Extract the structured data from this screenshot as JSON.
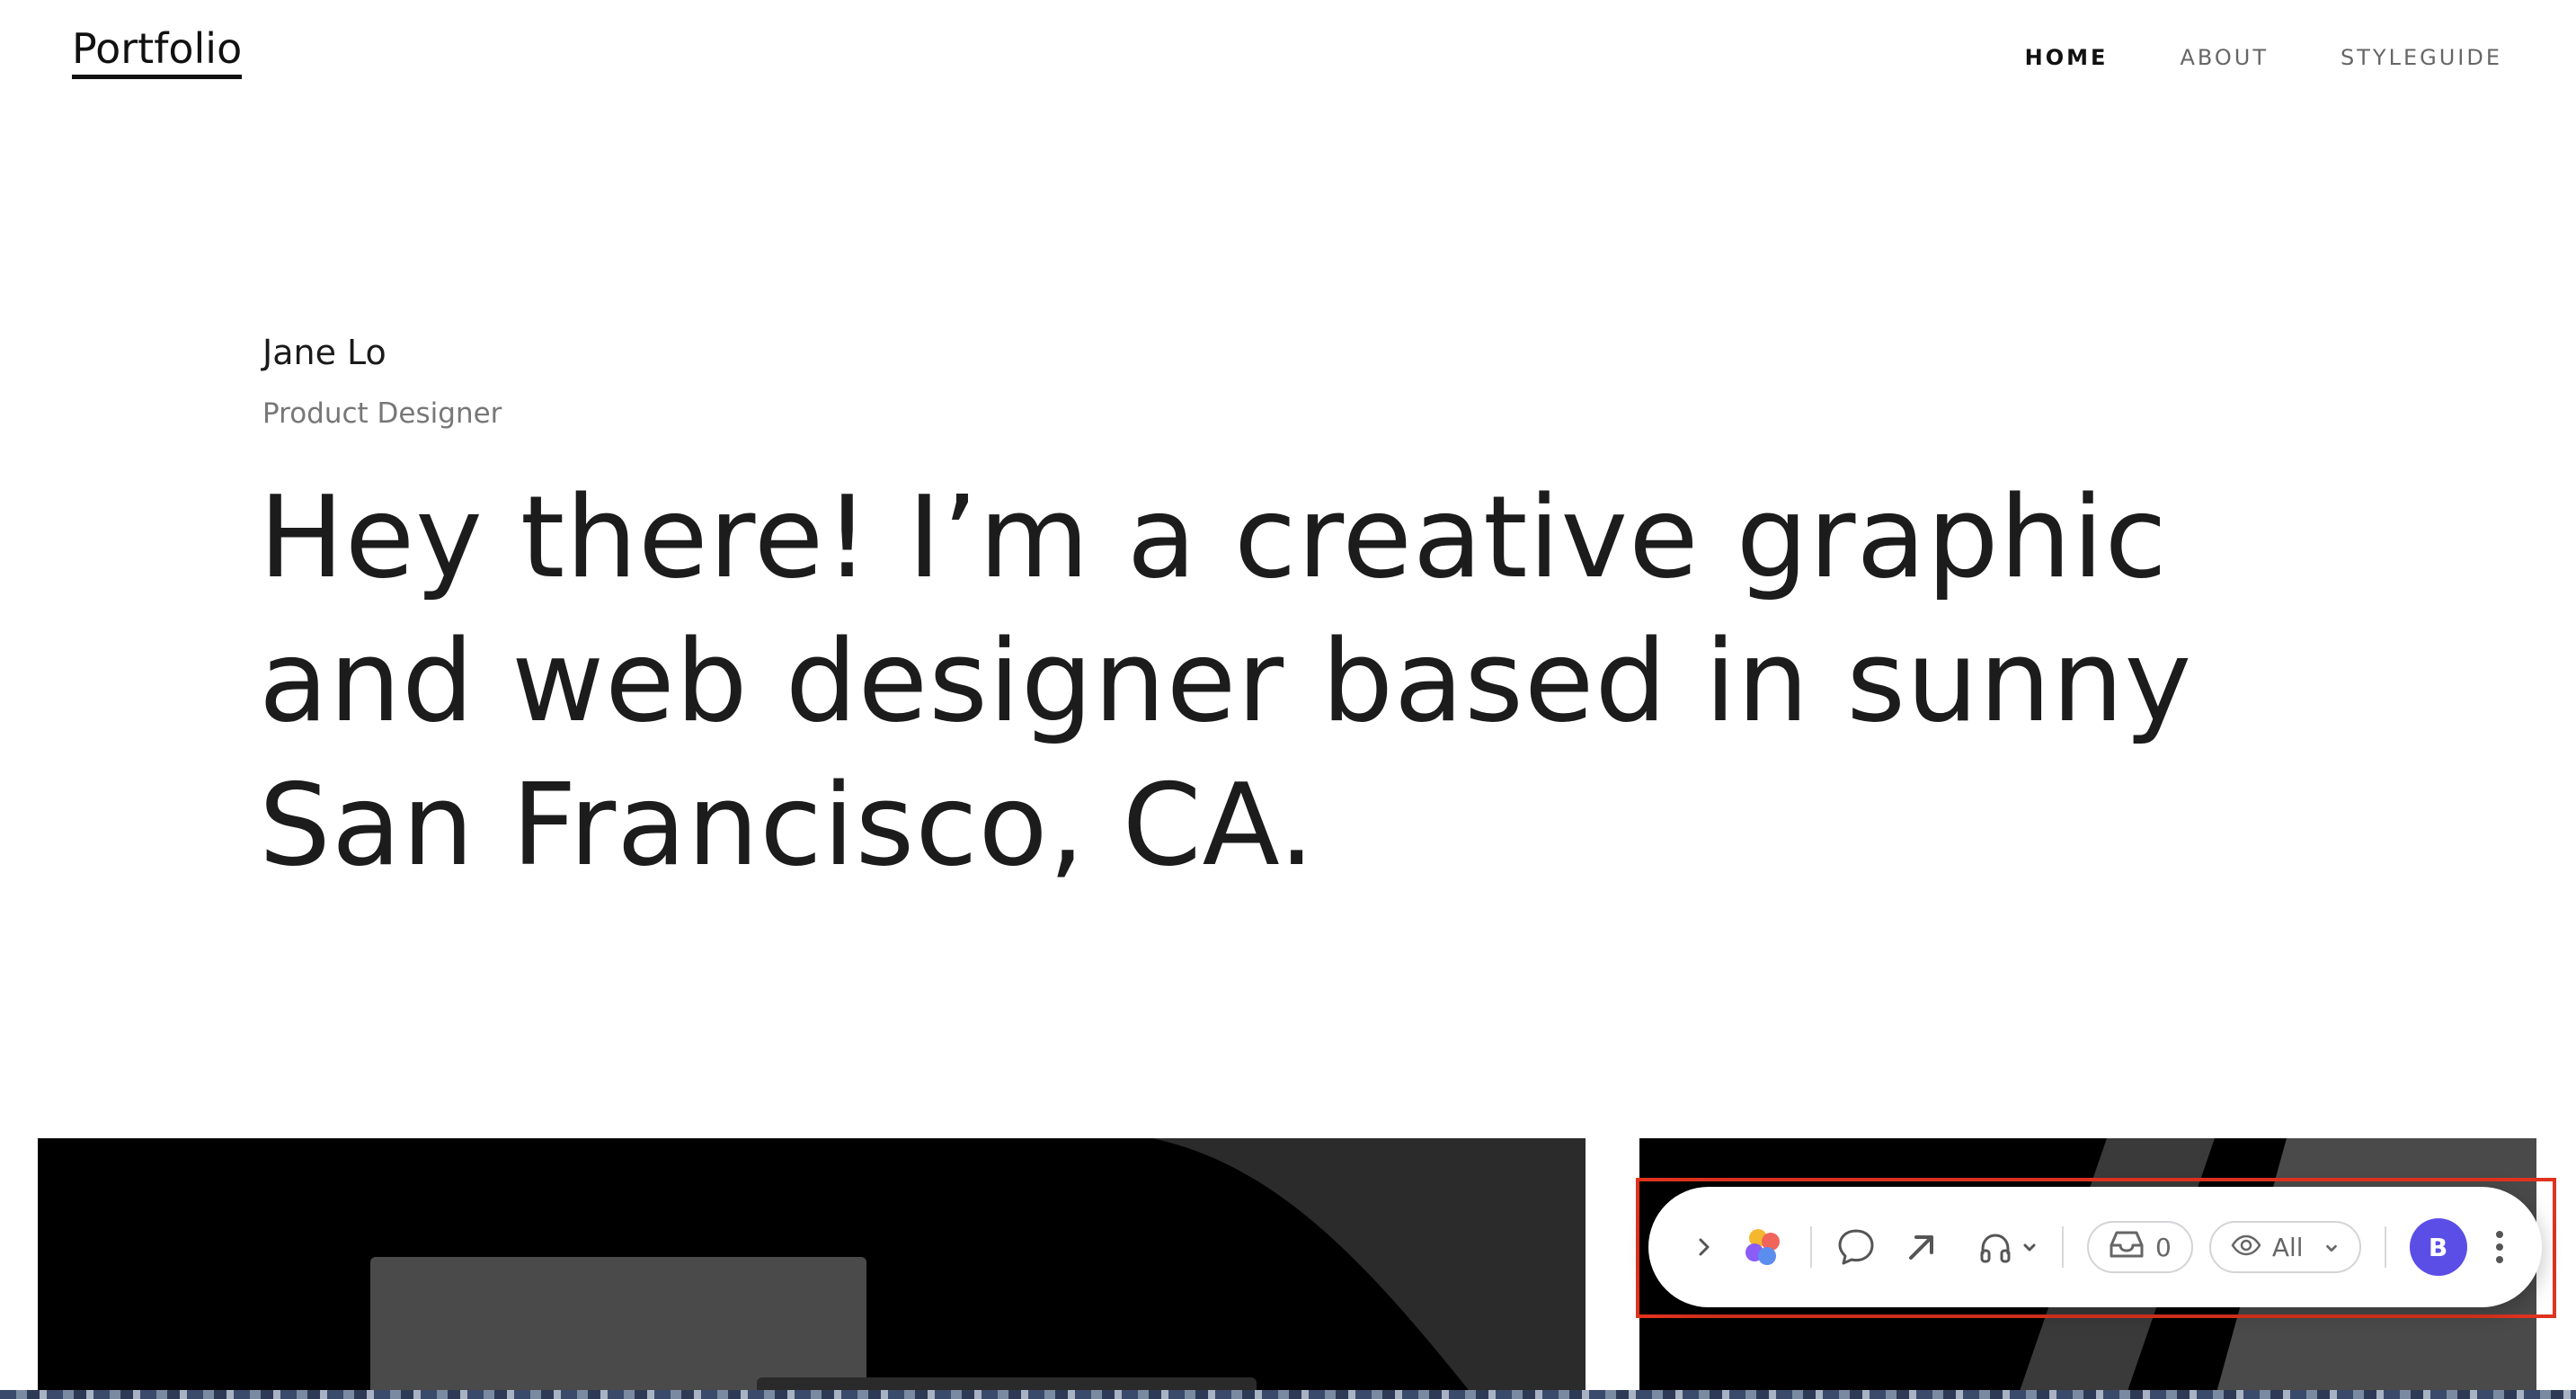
{
  "site": {
    "logo": "Portfolio"
  },
  "nav": {
    "items": [
      {
        "label": "HOME"
      },
      {
        "label": "ABOUT"
      },
      {
        "label": "STYLEGUIDE"
      }
    ]
  },
  "intro": {
    "name": "Jane Lo",
    "role": "Product Designer",
    "headline": "Hey there! I’m a creative graphic and web designer based in sunny San Francisco, CA."
  },
  "toolbar": {
    "expand_icon": "chevron-right-icon",
    "app_icon": "petal-logo-icon",
    "comment_icon": "speech-bubble-icon",
    "share_icon": "arrow-up-right-icon",
    "audio_icon": "headphones-icon",
    "inbox_count": "0",
    "visibility_label": "All",
    "avatar_initial": "B",
    "more_icon": "vertical-dots-icon",
    "accent_color": "#5b4ee6",
    "highlight_color": "#e0331f"
  }
}
